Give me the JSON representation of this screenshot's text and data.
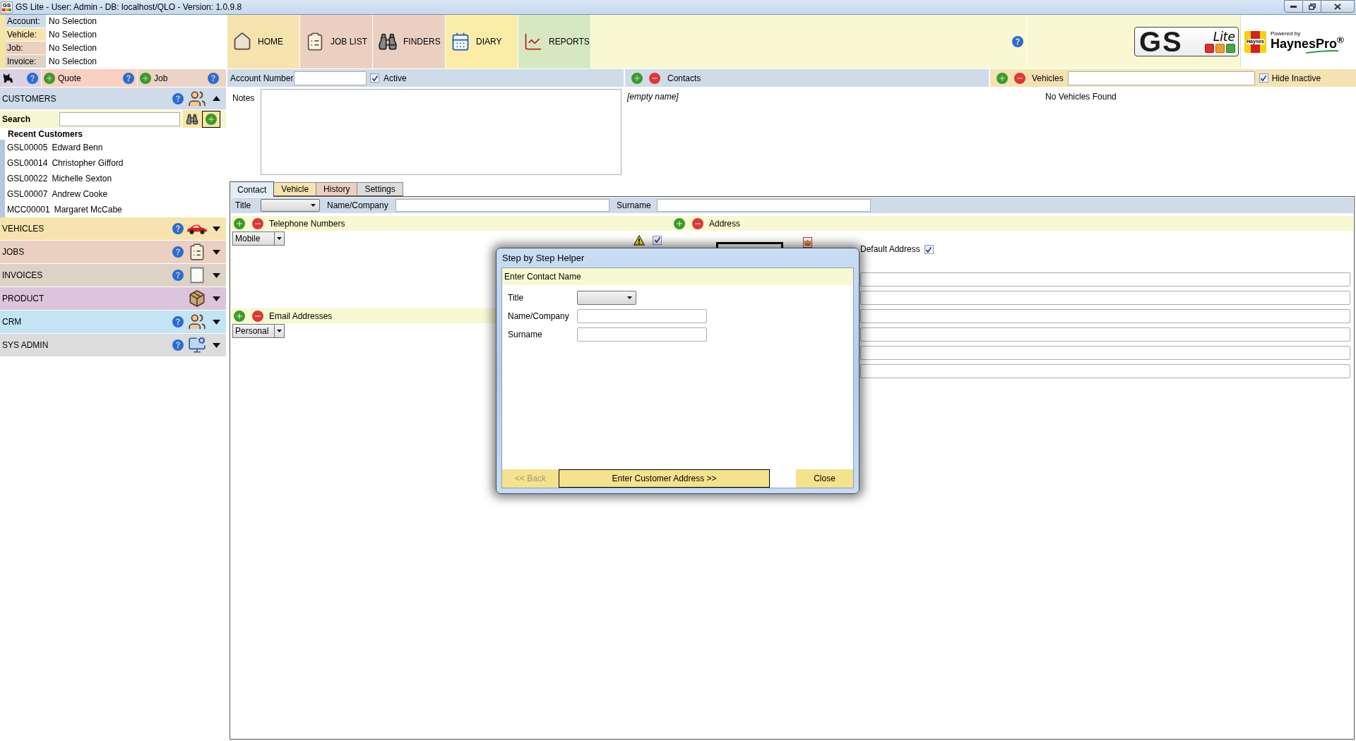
{
  "window": {
    "title": "GS Lite - User: Admin - DB: localhost/QLO - Version: 1.0.9.8",
    "icon_text": "GS"
  },
  "selection": [
    {
      "label": "Account:",
      "value": "No Selection",
      "color": "#cfdbe9"
    },
    {
      "label": "Vehicle:",
      "value": "No Selection",
      "color": "#f7e3b0"
    },
    {
      "label": "Job:",
      "value": "No Selection",
      "color": "#ebcfc1"
    },
    {
      "label": "Invoice:",
      "value": "No Selection",
      "color": "#dcd3c6"
    }
  ],
  "quick_actions": [
    {
      "kind": "cat",
      "color": "#dcd0e4"
    },
    {
      "kind": "add",
      "label": "Quote",
      "color": "#f9d0c2"
    },
    {
      "kind": "add",
      "label": "Job",
      "color": "#ebd3c6"
    }
  ],
  "customers": {
    "title": "CUSTOMERS",
    "kind": "people",
    "help": true,
    "expanded": true,
    "color": "#cfdbe9",
    "search_label": "Search",
    "recent_title": "Recent Customers",
    "recent": [
      {
        "code": "GSL00005",
        "name": "Edward Benn"
      },
      {
        "code": "GSL00014",
        "name": "Christopher Gifford"
      },
      {
        "code": "GSL00022",
        "name": "Michelle Sexton"
      },
      {
        "code": "GSL00007",
        "name": "Andrew Cooke"
      },
      {
        "code": "MCC00001",
        "name": "Margaret McCabe"
      }
    ]
  },
  "sections": [
    {
      "title": "VEHICLES",
      "kind": "car",
      "help": true,
      "expanded": false,
      "color": "#f7e3b0"
    },
    {
      "title": "JOBS",
      "kind": "clipboard",
      "help": true,
      "expanded": false,
      "color": "#ebd0c2"
    },
    {
      "title": "INVOICES",
      "kind": "invoice",
      "help": true,
      "expanded": false,
      "color": "#dcd3c6"
    },
    {
      "title": "PRODUCT",
      "kind": "product",
      "help": false,
      "expanded": false,
      "color": "#dcc4dc"
    },
    {
      "title": "CRM",
      "kind": "people",
      "help": true,
      "expanded": false,
      "color": "#c2e4f4"
    },
    {
      "title": "SYS ADMIN",
      "kind": "admin",
      "help": true,
      "expanded": false,
      "color": "#dcdcdc"
    }
  ],
  "nav": [
    {
      "label": "HOME",
      "kind": "home",
      "color": "#f7e3b0"
    },
    {
      "label": "JOB LIST",
      "kind": "clipboard",
      "color": "#ebd0c2"
    },
    {
      "label": "FINDERS",
      "kind": "binoculars",
      "color": "#ebd0c2"
    },
    {
      "label": "DIARY",
      "kind": "calendar",
      "color": "#fbeca8"
    },
    {
      "label": "REPORTS",
      "kind": "chart",
      "color": "#d6e8c2"
    }
  ],
  "logo": {
    "main": "GS",
    "sub": "Lite"
  },
  "partner": {
    "badge": "Haynes",
    "tagline": "Powered by",
    "name": "HaynesPro$^{®}$"
  },
  "account": {
    "label": "Account Number",
    "active": {
      "label": "Active",
      "checked": true
    },
    "notes_label": "Notes"
  },
  "contacts": {
    "title": "Contacts",
    "items": [
      {
        "name": "[empty name]"
      }
    ]
  },
  "vehicles": {
    "title": "Vehicles",
    "hide_inactive": {
      "label": "Hide Inactive",
      "checked": true
    },
    "empty_text": "No Vehicles Found"
  },
  "tabs": [
    {
      "label": "Contact",
      "selected": true,
      "color": "#e4ecf6"
    },
    {
      "label": "Vehicle",
      "selected": false,
      "color": "#f7e3b0"
    },
    {
      "label": "History",
      "selected": false,
      "color": "#ebd0c2"
    },
    {
      "label": "Settings",
      "selected": false,
      "color": "#dcdcdc"
    }
  ],
  "contact": {
    "title_label": "Title",
    "name_label": "Name/Company",
    "surname_label": "Surname",
    "telephone": {
      "title": "Telephone Numbers",
      "type": "Mobile",
      "flag_checked": true
    },
    "email": {
      "title": "Email Addresses",
      "type": "Personal"
    },
    "address": {
      "title": "Address",
      "default_label": "Default Address",
      "default_checked": true
    }
  },
  "dialog": {
    "title": "Step by Step Helper",
    "step": "Enter Contact Name",
    "fields": [
      {
        "kind": "select",
        "label": "Title"
      },
      {
        "kind": "text",
        "label": "Name/Company"
      },
      {
        "kind": "text",
        "label": "Surname"
      }
    ],
    "buttons": [
      {
        "label": "<< Back",
        "disabled": true,
        "focused": false
      },
      {
        "label": "Enter Customer Address >>",
        "disabled": false,
        "focused": true
      },
      {
        "label": "Close",
        "disabled": false,
        "focused": false
      }
    ]
  }
}
